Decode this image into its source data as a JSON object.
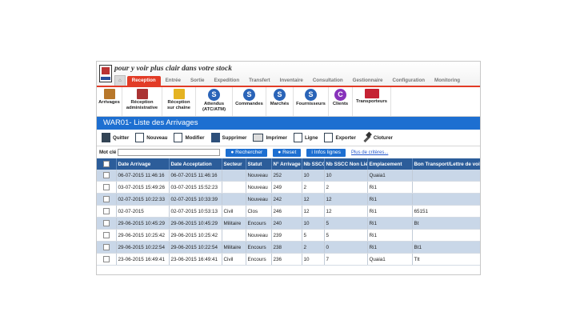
{
  "header": {
    "tagline": "pour y voir plus clair dans votre stock",
    "tabs": [
      "Reception",
      "Entrée",
      "Sortie",
      "Expedition",
      "Transfert",
      "Inventaire",
      "Consultation",
      "Gestionnaire",
      "Configuration",
      "Monitoring"
    ]
  },
  "toolbar": {
    "items": [
      {
        "label": "Arrivages",
        "icon": "box-icon"
      },
      {
        "label": "Réception\nadministrative",
        "icon": "box-icon"
      },
      {
        "label": "Réception\nsur chaîne",
        "icon": "box-icon"
      },
      {
        "label": "Attendus\n(ATC/ATM)",
        "icon": "s-icon"
      },
      {
        "label": "Commandes",
        "icon": "s-icon"
      },
      {
        "label": "Marchés",
        "icon": "s-icon"
      },
      {
        "label": "Fournisseurs",
        "icon": "s-icon"
      },
      {
        "label": "Clients",
        "icon": "c-icon"
      },
      {
        "label": "Transporteurs",
        "icon": "truck-icon"
      }
    ]
  },
  "page": {
    "title": "WAR01- Liste des Arrivages"
  },
  "actions": {
    "quit": "Quitter",
    "new": "Nouveau",
    "edit": "Modifier",
    "delete": "Supprimer",
    "print": "Imprimer",
    "line": "Ligne",
    "export": "Exporter",
    "close": "Cloturer"
  },
  "search": {
    "label": "Mot clé",
    "value": "",
    "search_button": "Rechercher",
    "reset_button": "Reset",
    "info_button": "Infos lignes",
    "criteria_link": "Plus de critères..."
  },
  "table": {
    "columns": [
      "Date Arrivage",
      "Date Acceptation",
      "Secteur",
      "Statut",
      "N° Arrivage",
      "Nb SSCC",
      "Nb SSCC Non Lié",
      "Emplacement",
      "Bon Transport/Lettre de voiture"
    ],
    "rows": [
      [
        "06-07-2015 11:46:16",
        "06-07-2015 11:46:16",
        "",
        "Nouveau",
        "252",
        "10",
        "10",
        "Quaia1",
        ""
      ],
      [
        "03-07-2015 15:49:26",
        "03-07-2015 15:52:23",
        "",
        "Nouveau",
        "249",
        "2",
        "2",
        "Ri1",
        ""
      ],
      [
        "02-07-2015 10:22:33",
        "02-07-2015 10:33:39",
        "",
        "Nouveau",
        "242",
        "12",
        "12",
        "Ri1",
        ""
      ],
      [
        "02-07-2015",
        "02-07-2015 10:53:13",
        "Civil",
        "Clos",
        "246",
        "12",
        "12",
        "Ri1",
        "65151"
      ],
      [
        "29-06-2015 10:45:29",
        "29-06-2015 10:45:29",
        "Militaire",
        "Encours",
        "240",
        "10",
        "5",
        "Ri1",
        "Bt"
      ],
      [
        "29-06-2015 10:25:42",
        "29-06-2015 10:25:42",
        "",
        "Nouveau",
        "239",
        "5",
        "5",
        "Ri1",
        ""
      ],
      [
        "29-06-2015 10:22:54",
        "29-06-2015 10:22:54",
        "Militaire",
        "Encours",
        "238",
        "2",
        "0",
        "Ri1",
        "Bt1"
      ],
      [
        "23-06-2015 16:49:41",
        "23-06-2015 16:49:41",
        "Civil",
        "Encours",
        "236",
        "10",
        "7",
        "Quaia1",
        "Tlt"
      ]
    ]
  }
}
